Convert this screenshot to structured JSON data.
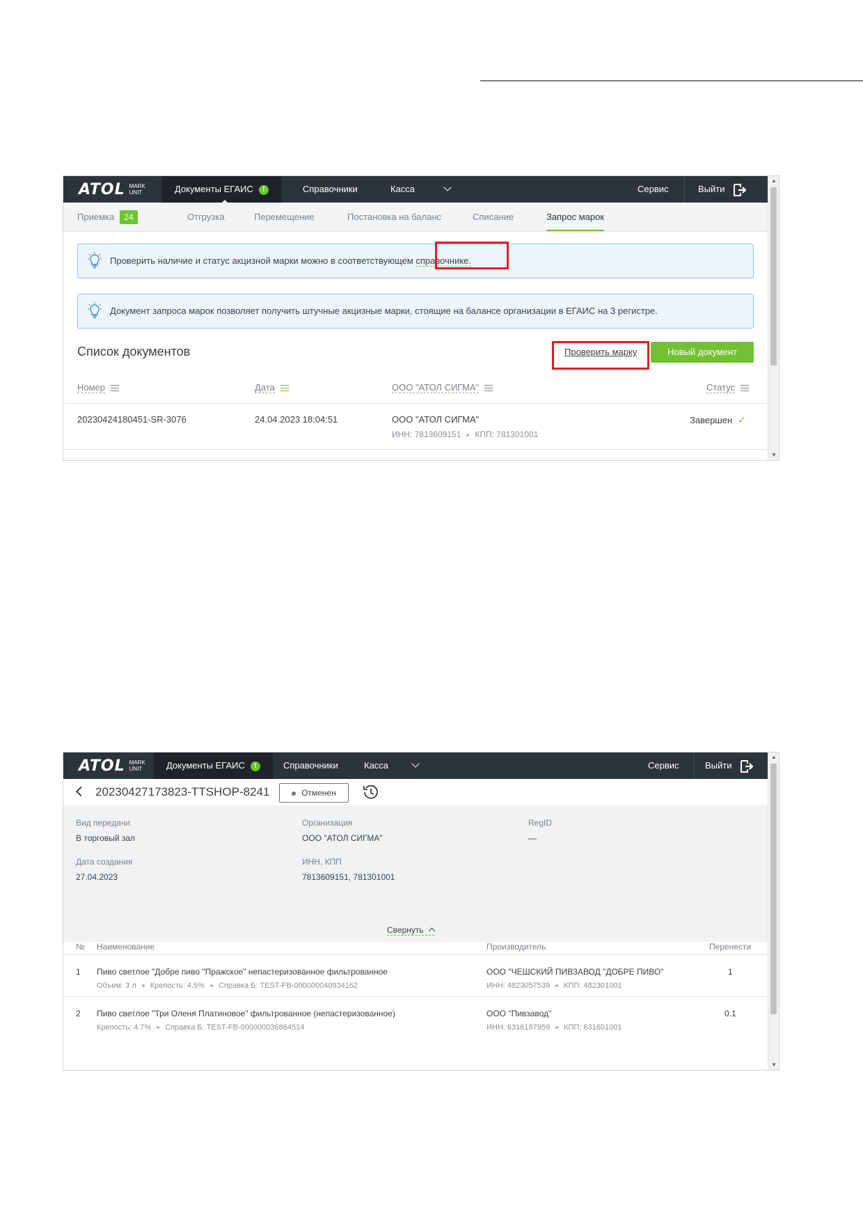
{
  "shot1": {
    "brand": {
      "word": "ATOL",
      "sub1": "MARK",
      "sub2": "UNIT"
    },
    "nav": {
      "documents": "Документы ЕГАИС",
      "badge": "!",
      "references": "Справочники",
      "kassa": "Касса",
      "service": "Сервис",
      "exit": "Выйти"
    },
    "tabs": {
      "priemka": "Приемка",
      "priemka_count": "24",
      "otgruzka": "Отгрузка",
      "peremeshchenie": "Перемещение",
      "postanovka": "Постановка на баланс",
      "spisanie": "Списание",
      "zapros": "Запрос марок"
    },
    "info1": {
      "text": "Проверить наличие и статус акцизной марки можно в соответствующем ",
      "link": "справочнике."
    },
    "info2": {
      "text": "Документ запроса марок позволяет получить штучные акцизные марки, стоящие на балансе организации в ЕГАИС на 3 регистре."
    },
    "list_title": "Список документов",
    "check_button": "Проверить марку",
    "new_button": "Новый документ",
    "columns": {
      "number": "Номер",
      "date": "Дата",
      "org": "ООО \"АТОЛ СИГМА\"",
      "status": "Статус"
    },
    "row": {
      "number": "20230424180451-SR-3076",
      "date": "24.04.2023 18:04:51",
      "org": "ООО \"АТОЛ СИГМА\"",
      "inn": "ИНН: 7813609151",
      "kpp": "КПП: 781301001",
      "status": "Завершен"
    }
  },
  "shot2": {
    "brand": {
      "word": "ATOL",
      "sub1": "MARK",
      "sub2": "UNIT"
    },
    "nav": {
      "documents": "Документы ЕГАИС",
      "badge": "!",
      "references": "Справочники",
      "kassa": "Касса",
      "service": "Сервис",
      "exit": "Выйти"
    },
    "doc_number": "20230427173823-TTSHOP-8241",
    "status": "Отменен",
    "meta": {
      "transfer_label": "Вид передачи",
      "transfer_value": "В торговый зал",
      "org_label": "Организация",
      "org_value": "ООО \"АТОЛ СИГМА\"",
      "regid_label": "RegID",
      "regid_value": "—",
      "created_label": "Дата создания",
      "created_value": "27.04.2023",
      "innkpp_label": "ИНН, КПП",
      "innkpp_value": "7813609151, 781301001",
      "collapse": "Свернуть"
    },
    "table": {
      "headers": {
        "num": "№",
        "name": "Наименование",
        "producer": "Производитель",
        "qty": "Перенести"
      },
      "rows": [
        {
          "num": "1",
          "name": "Пиво светлое \"Добре пиво \"Пражское\" непастеризованное фильтрованное",
          "details": [
            "Объем: 3 л",
            "Крепость: 4.5%",
            "Справка Б: TEST-FB-000000040934162"
          ],
          "producer": "ООО \"ЧЕШСКИЙ ПИВЗАВОД \"ДОБРЕ ПИВО\"",
          "inn": "ИНН: 4823057539",
          "kpp": "КПП: 482301001",
          "qty": "1"
        },
        {
          "num": "2",
          "name": "Пиво светлое \"Три Оленя Платиновое\" фильтрованное (непастеризованное)",
          "details": [
            "Крепость: 4.7%",
            "Справка Б: TEST-FB-000000036864514"
          ],
          "producer": "ООО \"Пивзавод\"",
          "inn": "ИНН: 6316187959",
          "kpp": "КПП: 631601001",
          "qty": "0.1"
        }
      ]
    }
  }
}
